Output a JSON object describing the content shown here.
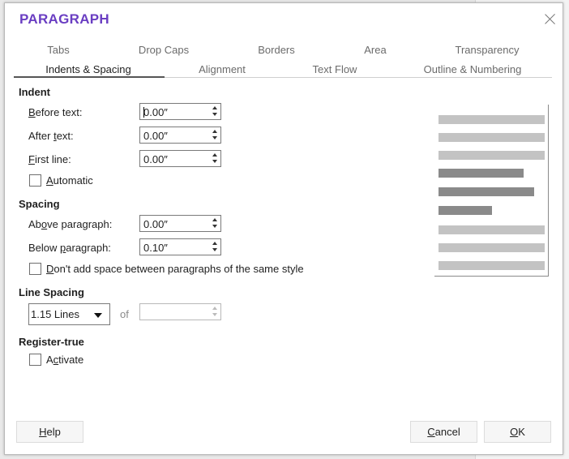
{
  "dialog": {
    "title": "PARAGRAPH",
    "tabs_row1": [
      "Tabs",
      "Drop Caps",
      "Borders",
      "Area",
      "Transparency"
    ],
    "tabs_row2": [
      "Indents & Spacing",
      "Alignment",
      "Text Flow",
      "Outline & Numbering"
    ],
    "active_tab": "Indents & Spacing"
  },
  "indent": {
    "heading": "Indent",
    "before_text": {
      "label_u": "B",
      "label_rest": "efore text:",
      "value": "0.00″"
    },
    "after_text": {
      "label_pre": "After ",
      "label_u": "t",
      "label_rest": "ext:",
      "value": "0.00″"
    },
    "first_line": {
      "label_u": "F",
      "label_rest": "irst line:",
      "value": "0.00″"
    },
    "automatic": {
      "label_u": "A",
      "label_rest": "utomatic",
      "checked": false
    }
  },
  "spacing": {
    "heading": "Spacing",
    "above": {
      "label_pre": "Ab",
      "label_u": "o",
      "label_rest": "ve paragraph:",
      "value": "0.00″"
    },
    "below": {
      "label_pre": "Below ",
      "label_u": "p",
      "label_rest": "aragraph:",
      "value": "0.10″"
    },
    "no_space": {
      "label_u": "D",
      "label_rest": "on't add space between paragraphs of the same style",
      "checked": false
    }
  },
  "line_spacing": {
    "heading": "Line Spacing",
    "selected": "1.15 Lines",
    "of_label": "of",
    "of_value": ""
  },
  "register_true": {
    "heading": "Register-true",
    "activate": {
      "label_pre": "A",
      "label_u": "c",
      "label_rest": "tivate",
      "checked": false
    }
  },
  "buttons": {
    "help": {
      "label_u": "H",
      "label_rest": "elp"
    },
    "cancel": {
      "label_u": "C",
      "label_rest": "ancel"
    },
    "ok": {
      "label_u": "O",
      "label_rest": "K"
    }
  },
  "colors": {
    "title": "#6a3ec2",
    "preview_light": "#c3c3c3",
    "preview_dark": "#8a8a8a"
  }
}
